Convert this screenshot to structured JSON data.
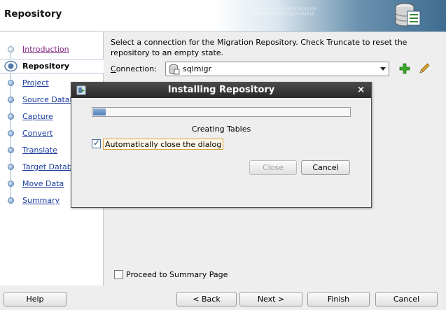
{
  "header": {
    "title": "Repository",
    "decoration_bits": "0101010101010101010101010\n101010101010101010101010"
  },
  "nav": {
    "items": [
      {
        "label": "Introduction",
        "state": "visited"
      },
      {
        "label": "Repository",
        "state": "active"
      },
      {
        "label": "Project",
        "state": "normal"
      },
      {
        "label": "Source Database",
        "state": "normal"
      },
      {
        "label": "Capture",
        "state": "normal"
      },
      {
        "label": "Convert",
        "state": "normal"
      },
      {
        "label": "Translate",
        "state": "normal"
      },
      {
        "label": "Target Database",
        "state": "normal"
      },
      {
        "label": "Move Data",
        "state": "normal"
      },
      {
        "label": "Summary",
        "state": "normal"
      }
    ]
  },
  "main": {
    "instructions": "Select a connection for the Migration Repository.  Check Truncate to reset the repository to an empty state.",
    "connection_label_mnemonic": "C",
    "connection_label_rest": "onnection:",
    "connection_value": "sqlmigr",
    "proceed_label": "Proceed to Summary Page",
    "proceed_checked": false,
    "add_icon": "green-plus-icon",
    "edit_icon": "pencil-icon"
  },
  "footer": {
    "help": "Help",
    "back": "< Back",
    "next": "Next >",
    "finish": "Finish",
    "cancel": "Cancel"
  },
  "dialog": {
    "title": "Installing Repository",
    "close_glyph": "×",
    "progress_fraction": 0.05,
    "status": "Creating Tables",
    "auto_close_label": "Automatically close the dialog",
    "auto_close_checked": true,
    "close_button": "Close",
    "cancel_button": "Cancel"
  },
  "colors": {
    "link": "#1a3d9c",
    "visited_link": "#7d1e7d",
    "dialog_title_bg": "#3a3a3a",
    "progress": "#4f7fb8",
    "focus_border": "#d8a23a"
  }
}
